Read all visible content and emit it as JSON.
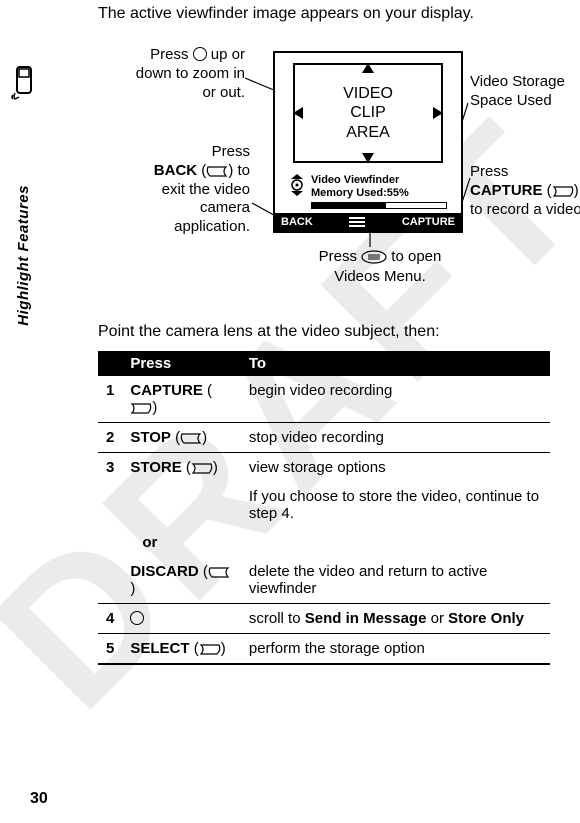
{
  "page": {
    "draft_watermark": "DRAFT",
    "side_label": "Highlight Features",
    "intro": "The active viewfinder image appears on your display.",
    "instruction": "Point the camera lens at the video subject, then:",
    "page_number": "30"
  },
  "screen": {
    "viewfinder_text": "VIDEO CLIP AREA",
    "status_line1": "Video Viewfinder",
    "status_line2_prefix": "Memory Used:",
    "memory_pct": "55%",
    "memory_fill_pct": 55,
    "softkey_left": "BACK",
    "softkey_right": "CAPTURE"
  },
  "callouts": {
    "zoom": "Press      up or down to zoom in or out.",
    "back_line1": "Press",
    "back_bold": "BACK",
    "back_line2": " to exit the video camera application.",
    "storage": "Video Storage Space Used",
    "capture_line1": "Press",
    "capture_bold": "CAPTURE",
    "capture_line2": " to record a video.",
    "menu_pre": "Press ",
    "menu_post": " to open ",
    "menu_bold": "Videos Menu",
    "menu_end": "."
  },
  "table": {
    "header_press": "Press",
    "header_to": "To",
    "rows": [
      {
        "n": "1",
        "action": "CAPTURE",
        "result": "begin video recording"
      },
      {
        "n": "2",
        "action": "STOP",
        "result": "stop video recording"
      },
      {
        "n": "3",
        "action": "STORE",
        "result": "view storage options"
      },
      {
        "n": "",
        "action": "",
        "result": "If you choose to store the video, continue to step 4."
      },
      {
        "n": "",
        "action": "or",
        "result": ""
      },
      {
        "n": "",
        "action": "DISCARD",
        "result": "delete the video and return to active viewfinder"
      },
      {
        "n": "4",
        "action": "",
        "result_pre": "scroll to ",
        "result_b1": "Send in Message",
        "result_mid": " or ",
        "result_b2": "Store Only"
      },
      {
        "n": "5",
        "action": "SELECT",
        "result": "perform the storage option"
      }
    ]
  }
}
